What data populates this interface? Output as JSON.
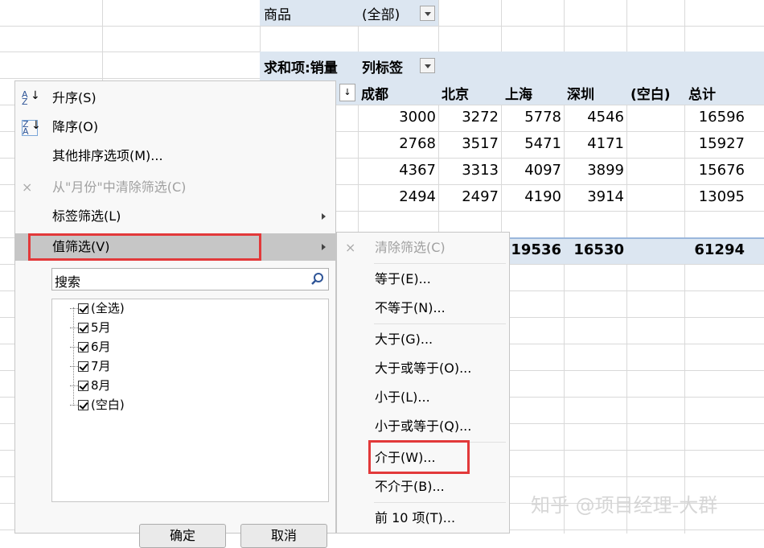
{
  "pivot": {
    "filter_label": "商品",
    "filter_value": "(全部)",
    "sum_label": "求和项:销量",
    "col_label": "列标签",
    "columns": [
      "成都",
      "北京",
      "上海",
      "深圳",
      "(空白)",
      "总计"
    ],
    "rows": [
      [
        "3000",
        "3272",
        "5778",
        "4546",
        "",
        "16596"
      ],
      [
        "2768",
        "3517",
        "5471",
        "4171",
        "",
        "15927"
      ],
      [
        "4367",
        "3313",
        "4097",
        "3899",
        "",
        "15676"
      ],
      [
        "2494",
        "2497",
        "4190",
        "3914",
        "",
        "13095"
      ]
    ],
    "total_row": [
      "19536",
      "16530",
      "",
      "61294"
    ]
  },
  "menu": {
    "sort_asc": "升序(S)",
    "sort_desc": "降序(O)",
    "more_sort": "其他排序选项(M)...",
    "clear_filter": "从\"月份\"中清除筛选(C)",
    "label_filter": "标签筛选(L)",
    "value_filter": "值筛选(V)",
    "search_placeholder": "搜索",
    "tree": [
      "(全选)",
      "5月",
      "6月",
      "7月",
      "8月",
      "(空白)"
    ],
    "ok": "确定",
    "cancel": "取消"
  },
  "submenu": {
    "clear": "清除筛选(C)",
    "items": [
      "等于(E)...",
      "不等于(N)...",
      "大于(G)...",
      "大于或等于(O)...",
      "小于(L)...",
      "小于或等于(Q)...",
      "介于(W)...",
      "不介于(B)...",
      "前 10 项(T)..."
    ]
  },
  "watermark": "知乎 @项目经理-大群",
  "colors": {
    "header_band": "#dce6f1",
    "highlight": "#e2393a",
    "menu_hover": "#c6c6c6"
  },
  "icons": [
    "sort-az-icon",
    "sort-za-icon",
    "clear-filter-icon",
    "search-icon",
    "submenu-arrow-icon",
    "dropdown-arrow-icon"
  ]
}
